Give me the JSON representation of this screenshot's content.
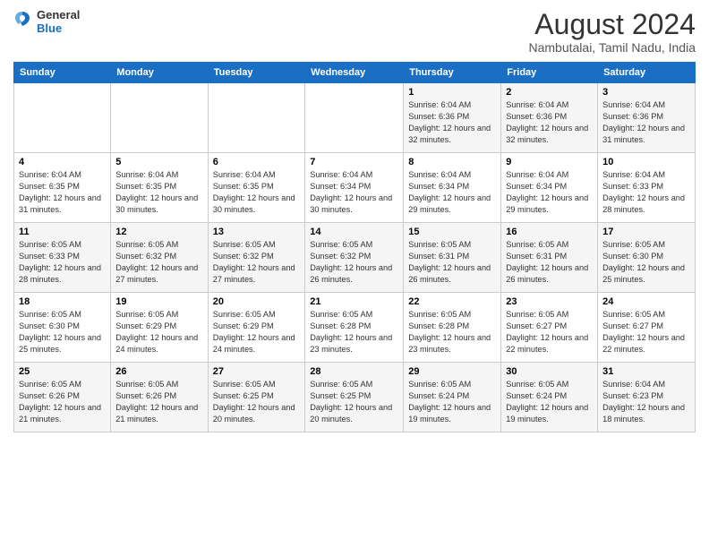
{
  "header": {
    "logo_line1": "General",
    "logo_line2": "Blue",
    "month_title": "August 2024",
    "location": "Nambutalai, Tamil Nadu, India"
  },
  "days_of_week": [
    "Sunday",
    "Monday",
    "Tuesday",
    "Wednesday",
    "Thursday",
    "Friday",
    "Saturday"
  ],
  "weeks": [
    [
      {
        "day": "",
        "info": ""
      },
      {
        "day": "",
        "info": ""
      },
      {
        "day": "",
        "info": ""
      },
      {
        "day": "",
        "info": ""
      },
      {
        "day": "1",
        "info": "Sunrise: 6:04 AM\nSunset: 6:36 PM\nDaylight: 12 hours\nand 32 minutes."
      },
      {
        "day": "2",
        "info": "Sunrise: 6:04 AM\nSunset: 6:36 PM\nDaylight: 12 hours\nand 32 minutes."
      },
      {
        "day": "3",
        "info": "Sunrise: 6:04 AM\nSunset: 6:36 PM\nDaylight: 12 hours\nand 31 minutes."
      }
    ],
    [
      {
        "day": "4",
        "info": "Sunrise: 6:04 AM\nSunset: 6:35 PM\nDaylight: 12 hours\nand 31 minutes."
      },
      {
        "day": "5",
        "info": "Sunrise: 6:04 AM\nSunset: 6:35 PM\nDaylight: 12 hours\nand 30 minutes."
      },
      {
        "day": "6",
        "info": "Sunrise: 6:04 AM\nSunset: 6:35 PM\nDaylight: 12 hours\nand 30 minutes."
      },
      {
        "day": "7",
        "info": "Sunrise: 6:04 AM\nSunset: 6:34 PM\nDaylight: 12 hours\nand 30 minutes."
      },
      {
        "day": "8",
        "info": "Sunrise: 6:04 AM\nSunset: 6:34 PM\nDaylight: 12 hours\nand 29 minutes."
      },
      {
        "day": "9",
        "info": "Sunrise: 6:04 AM\nSunset: 6:34 PM\nDaylight: 12 hours\nand 29 minutes."
      },
      {
        "day": "10",
        "info": "Sunrise: 6:04 AM\nSunset: 6:33 PM\nDaylight: 12 hours\nand 28 minutes."
      }
    ],
    [
      {
        "day": "11",
        "info": "Sunrise: 6:05 AM\nSunset: 6:33 PM\nDaylight: 12 hours\nand 28 minutes."
      },
      {
        "day": "12",
        "info": "Sunrise: 6:05 AM\nSunset: 6:32 PM\nDaylight: 12 hours\nand 27 minutes."
      },
      {
        "day": "13",
        "info": "Sunrise: 6:05 AM\nSunset: 6:32 PM\nDaylight: 12 hours\nand 27 minutes."
      },
      {
        "day": "14",
        "info": "Sunrise: 6:05 AM\nSunset: 6:32 PM\nDaylight: 12 hours\nand 26 minutes."
      },
      {
        "day": "15",
        "info": "Sunrise: 6:05 AM\nSunset: 6:31 PM\nDaylight: 12 hours\nand 26 minutes."
      },
      {
        "day": "16",
        "info": "Sunrise: 6:05 AM\nSunset: 6:31 PM\nDaylight: 12 hours\nand 26 minutes."
      },
      {
        "day": "17",
        "info": "Sunrise: 6:05 AM\nSunset: 6:30 PM\nDaylight: 12 hours\nand 25 minutes."
      }
    ],
    [
      {
        "day": "18",
        "info": "Sunrise: 6:05 AM\nSunset: 6:30 PM\nDaylight: 12 hours\nand 25 minutes."
      },
      {
        "day": "19",
        "info": "Sunrise: 6:05 AM\nSunset: 6:29 PM\nDaylight: 12 hours\nand 24 minutes."
      },
      {
        "day": "20",
        "info": "Sunrise: 6:05 AM\nSunset: 6:29 PM\nDaylight: 12 hours\nand 24 minutes."
      },
      {
        "day": "21",
        "info": "Sunrise: 6:05 AM\nSunset: 6:28 PM\nDaylight: 12 hours\nand 23 minutes."
      },
      {
        "day": "22",
        "info": "Sunrise: 6:05 AM\nSunset: 6:28 PM\nDaylight: 12 hours\nand 23 minutes."
      },
      {
        "day": "23",
        "info": "Sunrise: 6:05 AM\nSunset: 6:27 PM\nDaylight: 12 hours\nand 22 minutes."
      },
      {
        "day": "24",
        "info": "Sunrise: 6:05 AM\nSunset: 6:27 PM\nDaylight: 12 hours\nand 22 minutes."
      }
    ],
    [
      {
        "day": "25",
        "info": "Sunrise: 6:05 AM\nSunset: 6:26 PM\nDaylight: 12 hours\nand 21 minutes."
      },
      {
        "day": "26",
        "info": "Sunrise: 6:05 AM\nSunset: 6:26 PM\nDaylight: 12 hours\nand 21 minutes."
      },
      {
        "day": "27",
        "info": "Sunrise: 6:05 AM\nSunset: 6:25 PM\nDaylight: 12 hours\nand 20 minutes."
      },
      {
        "day": "28",
        "info": "Sunrise: 6:05 AM\nSunset: 6:25 PM\nDaylight: 12 hours\nand 20 minutes."
      },
      {
        "day": "29",
        "info": "Sunrise: 6:05 AM\nSunset: 6:24 PM\nDaylight: 12 hours\nand 19 minutes."
      },
      {
        "day": "30",
        "info": "Sunrise: 6:05 AM\nSunset: 6:24 PM\nDaylight: 12 hours\nand 19 minutes."
      },
      {
        "day": "31",
        "info": "Sunrise: 6:04 AM\nSunset: 6:23 PM\nDaylight: 12 hours\nand 18 minutes."
      }
    ]
  ]
}
